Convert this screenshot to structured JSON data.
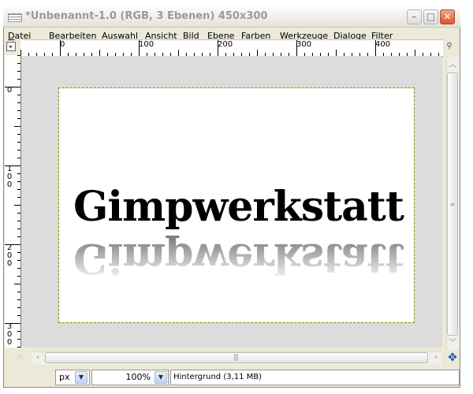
{
  "window": {
    "title": "*Unbenannt-1.0 (RGB, 3 Ebenen) 450x300",
    "controls": {
      "minimize": "–",
      "maximize": "□",
      "close": "✕"
    }
  },
  "menubar": {
    "items": [
      {
        "id": "datei",
        "accel": "D",
        "rest": "atei"
      },
      {
        "id": "bearbeiten",
        "accel": "",
        "rest": "Bearbeite",
        "tail_accel": "n"
      },
      {
        "id": "auswahl",
        "accel": "A",
        "rest": "uswahl"
      },
      {
        "id": "ansicht",
        "accel": "",
        "rest": "An",
        "mid_accel": "s",
        "tail": "icht"
      },
      {
        "id": "bild",
        "accel": "B",
        "rest": "ild"
      },
      {
        "id": "ebene",
        "accel": "E",
        "rest": "bene"
      },
      {
        "id": "farben",
        "accel": "F",
        "rest": "arben"
      },
      {
        "id": "werkzeuge",
        "accel": "W",
        "rest": "erkzeuge"
      },
      {
        "id": "dialoge",
        "accel": "D",
        "rest": "ialoge"
      },
      {
        "id": "filter",
        "accel": "",
        "rest": "Filte",
        "tail_accel": "r"
      }
    ]
  },
  "rulers": {
    "horizontal_labels": [
      "0",
      "100",
      "200",
      "300",
      "400"
    ],
    "vertical_labels": [
      "0",
      "100",
      "200",
      "300"
    ]
  },
  "canvas": {
    "image_text": "Gimpwerkstatt"
  },
  "statusbar": {
    "unit": "px",
    "zoom": "100%",
    "layer_info": "Hintergrund (3,11 MB)"
  },
  "icons": {
    "menu_arrow": "menu-arrow-icon",
    "zoom": "zoom-icon",
    "navigate": "navigate-icon",
    "quickmask": "quickmask-icon"
  }
}
